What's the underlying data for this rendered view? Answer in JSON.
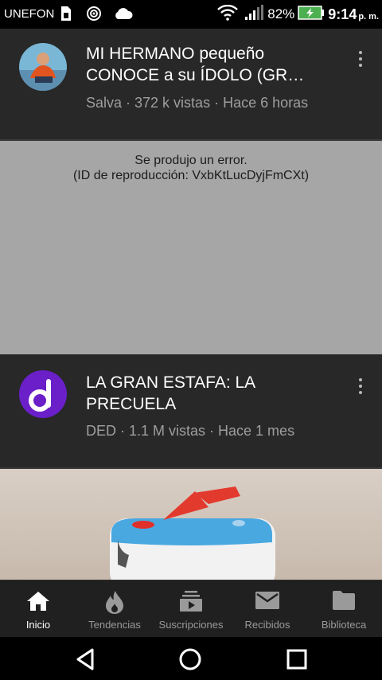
{
  "status_bar": {
    "carrier": "UNEFON",
    "battery_percent": "82%",
    "time": "9:14",
    "ampm": "p. m.",
    "icons": [
      "sim-card-icon",
      "hotspot-icon",
      "cloud-icon",
      "wifi-icon",
      "signal-icon",
      "battery-charging-icon"
    ]
  },
  "feed": {
    "items": [
      {
        "title": "MI HERMANO pequeño CONOCE a su ÍDOLO (GR…",
        "channel": "Salva",
        "views": "372 k vistas",
        "age": "Hace 6 horas",
        "meta": "Salva · 372 k vistas · Hace 6 horas"
      },
      {
        "title": "LA GRAN ESTAFA: LA PRECUELA",
        "channel": "DED",
        "views": "1.1 M vistas",
        "age": "Hace 1 mes",
        "meta": "DED · 1.1 M vistas · Hace 1 mes"
      }
    ]
  },
  "player_error": {
    "message": "Se produjo un error.",
    "playback_id": "(ID de reproducción: VxbKtLucDyjFmCXt)"
  },
  "tab_bar": {
    "tabs": [
      {
        "label": "Inicio",
        "icon": "home-icon",
        "active": true
      },
      {
        "label": "Tendencias",
        "icon": "flame-icon",
        "active": false
      },
      {
        "label": "Suscripciones",
        "icon": "subscriptions-icon",
        "active": false
      },
      {
        "label": "Recibidos",
        "icon": "mail-icon",
        "active": false
      },
      {
        "label": "Biblioteca",
        "icon": "folder-icon",
        "active": false
      }
    ]
  },
  "nav_bar": {
    "buttons": [
      "back-icon",
      "home-circle-icon",
      "recents-icon"
    ]
  },
  "colors": {
    "background": "#282828",
    "error_panel": "#a6a6a6",
    "meta_text": "#9e9e9e",
    "tab_bar": "#202020",
    "battery_green": "#4caf50",
    "ded_purple": "#6a1fc9"
  }
}
